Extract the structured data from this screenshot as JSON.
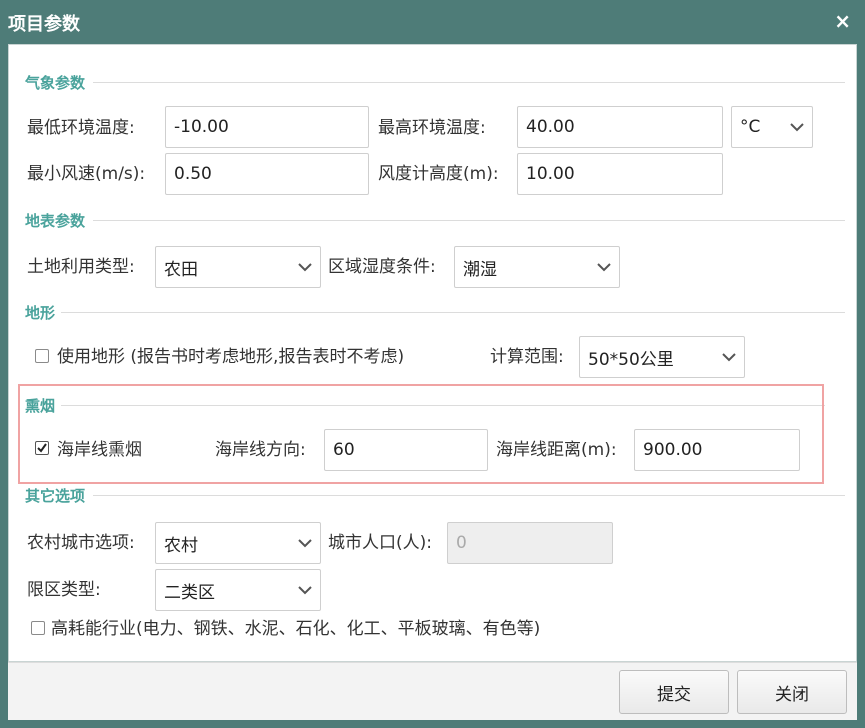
{
  "window": {
    "title": "项目参数",
    "close_glyph": "×"
  },
  "meteorology": {
    "legend": "气象参数",
    "min_temp_label": "最低环境温度:",
    "min_temp_value": "-10.00",
    "max_temp_label": "最高环境温度:",
    "max_temp_value": "40.00",
    "temp_unit": "°C",
    "min_wind_label": "最小风速(m/s):",
    "min_wind_value": "0.50",
    "anemometer_label": "风度计高度(m):",
    "anemometer_value": "10.00"
  },
  "surface": {
    "legend": "地表参数",
    "land_use_label": "土地利用类型:",
    "land_use_value": "农田",
    "humidity_label": "区域湿度条件:",
    "humidity_value": "潮湿"
  },
  "terrain": {
    "legend": "地形",
    "use_terrain_label": "使用地形 (报告书时考虑地形,报告表时不考虑)",
    "use_terrain_checked": false,
    "range_label": "计算范围:",
    "range_value": "50*50公里"
  },
  "fumigation": {
    "legend": "熏烟",
    "coastal_label": "海岸线熏烟",
    "coastal_checked": true,
    "direction_label": "海岸线方向:",
    "direction_value": "60",
    "distance_label": "海岸线距离(m):",
    "distance_value": "900.00"
  },
  "other": {
    "legend": "其它选项",
    "urban_rural_label": "农村城市选项:",
    "urban_rural_value": "农村",
    "population_label": "城市人口(人):",
    "population_value": "0",
    "zone_label": "限区类型:",
    "zone_value": "二类区",
    "energy_label": "高耗能行业(电力、钢铁、水泥、石化、化工、平板玻璃、有色等)",
    "energy_checked": false
  },
  "footer": {
    "submit_label": "提交",
    "close_label": "关闭"
  },
  "colors": {
    "title_bar": "#4e7c78",
    "legend_text": "#4aa39c",
    "highlight_border": "#f0a3a3"
  }
}
